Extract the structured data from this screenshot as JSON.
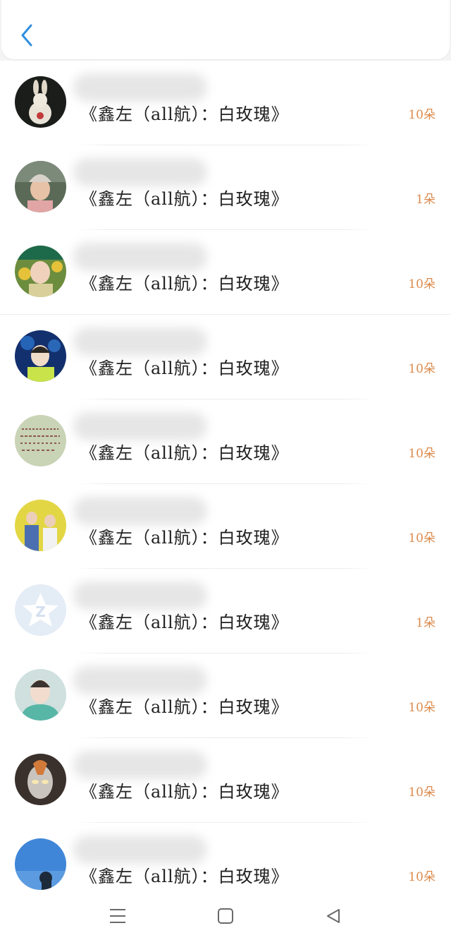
{
  "header": {
    "back_icon": "chevron-left-icon",
    "accent": "#2f8fe0"
  },
  "items": [
    {
      "title": "《鑫左（all航）：白玫瑰》",
      "count": "10朵",
      "avatar": "rabbit-avatar"
    },
    {
      "title": "《鑫左（all航）：白玫瑰》",
      "count": "1朵",
      "avatar": "girl-beanie-avatar"
    },
    {
      "title": "《鑫左（all航）：白玫瑰》",
      "count": "10朵",
      "avatar": "sunflower-avatar"
    },
    {
      "title": "《鑫左（all航）：白玫瑰》",
      "count": "10朵",
      "avatar": "blue-stage-avatar"
    },
    {
      "title": "《鑫左（all航）：白玫瑰》",
      "count": "10朵",
      "avatar": "handwriting-avatar"
    },
    {
      "title": "《鑫左（all航）：白玫瑰》",
      "count": "10朵",
      "avatar": "yellow-wall-avatar"
    },
    {
      "title": "《鑫左（all航）：白玫瑰》",
      "count": "1朵",
      "avatar": "qzone-default-avatar"
    },
    {
      "title": "《鑫左（all航）：白玫瑰》",
      "count": "10朵",
      "avatar": "teal-hoodie-avatar"
    },
    {
      "title": "《鑫左（all航）：白玫瑰》",
      "count": "10朵",
      "avatar": "ultraman-avatar"
    },
    {
      "title": "《鑫左（all航）：白玫瑰》",
      "count": "10朵",
      "avatar": "sky-avatar"
    }
  ],
  "count_color": "#dc8a4c",
  "navbar": {
    "menu_icon": "menu-icon",
    "home_icon": "square-home-icon",
    "back_icon": "triangle-back-icon"
  }
}
